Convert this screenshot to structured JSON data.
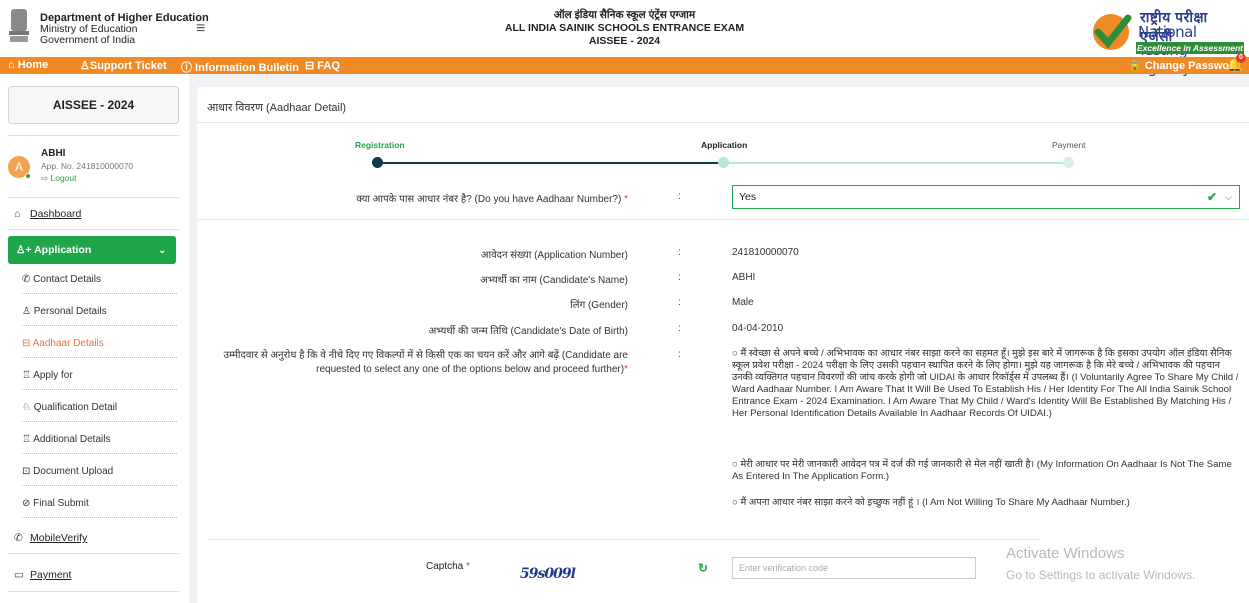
{
  "header": {
    "dept_name": "Department of Higher Education",
    "ministry": "Ministry of Education",
    "gov": "Government of India",
    "title_hindi": "ऑल इंडिया सैनिक स्कूल एंट्रेंस एग्जाम",
    "title_en": "ALL INDIA SAINIK SCHOOLS ENTRANCE EXAM",
    "title_code": "AISSEE - 2024",
    "nta_hindi": "राष्ट्रीय परीक्षा एजेंसी",
    "nta_en": "National Testing Agency",
    "nta_tagline": "Excellence in Assessment"
  },
  "navbar": {
    "home": "⌂ Home",
    "support": "♙Support Ticket",
    "info": "ⓘ Information Bulletin",
    "faq": "⊟ FAQ",
    "change_password": "🔒 Change Password",
    "notif_count": "0"
  },
  "sidebar": {
    "exam": "AISSEE - 2024",
    "avatar_letter": "A",
    "user_name": "ABHI",
    "app_no": "App. No. 241810000070",
    "logout": "Logout",
    "dashboard": "Dashboard",
    "application": "Application",
    "sub_items": [
      "Contact Details",
      "Personal Details",
      "Aadhaar Details",
      "Apply for",
      "Qualification Detail",
      "Additional Details",
      "Document Upload",
      "Final Submit"
    ],
    "mobile_verify": "MobileVerify",
    "payment": "Payment"
  },
  "main": {
    "heading": "आधार विवरण (Aadhaar Detail)",
    "steps": [
      "Registration",
      "Application",
      "Payment"
    ],
    "q_aadhaar": "क्या आपके पास आधार नंबर है? (Do you have Aadhaar Number?)",
    "q_aadhaar_value": "Yes",
    "fields": [
      {
        "label": "आवेदन संख्या (Application Number)",
        "value": "241810000070"
      },
      {
        "label": "अभ्यर्थी का नाम (Candidate's Name)",
        "value": "ABHI"
      },
      {
        "label": "लिंग (Gender)",
        "value": "Male"
      },
      {
        "label": "अभ्यर्थी की जन्म तिथि (Candidate's Date of Birth)",
        "value": "04-04-2010"
      }
    ],
    "options_label_1": "उम्मीदवार से अनुरोध है कि वे नीचे दिए गए विकल्पों में से किसी एक का चयन करें और आगे बढ़ें (Candidate are",
    "options_label_2": "requested to select any one of the options below and proceed further)",
    "option1": "○ मैं स्वेच्छा से अपने बच्चे / अभिभावक का आधार नंबर साझा करने का सहमत हूँ। मुझे इस बारे में जागरूक है कि इसका उपयोग ऑल इंडिया सैनिक स्कूल प्रवेश परीक्षा - 2024 परीक्षा के लिए उसकी पहचान स्थापित करने के लिए होगा। मुझे यह जागरूक है कि मेरे बच्चे / अभिभावक की पहचान उनकी व्यक्तिगत पहचान विवरणों की जांच करके होगी जो UIDAI के आधार रिकॉर्ड्स में उपलब्ध हैं। (I Voluntarily Agree To Share My Child / Ward Aadhaar Number. I Am Aware That It Will Be Used To Establish His / Her Identity For The All India Sainik School Entrance Exam - 2024 Examination. I Am Aware That My Child / Ward's Identity Will Be Established By Matching His / Her Personal Identification Details Available In Aadhaar Records Of UIDAI.)",
    "option2": "○ मेरी आधार पर मेरी जानकारी आवेदन पत्र में दर्ज की गई जानकारी से मेल नहीं खाती है। (My Information On Aadhaar Is Not The Same As Entered In The Application Form.)",
    "option3": "○ मैं अपना आधार नंबर साझा करने को इच्छुक नहीं हूं । (I Am Not Willing To Share My Aadhaar Number.)",
    "captcha_label": "Captcha",
    "captcha_text": "59s009l",
    "captcha_placeholder": "Enter verification code",
    "watermark1": "Activate Windows",
    "watermark2": "Go to Settings to activate Windows."
  },
  "colors": {
    "accent": "#1fa54a",
    "nav": "#f08a24",
    "active_sub": "#e8723a"
  }
}
